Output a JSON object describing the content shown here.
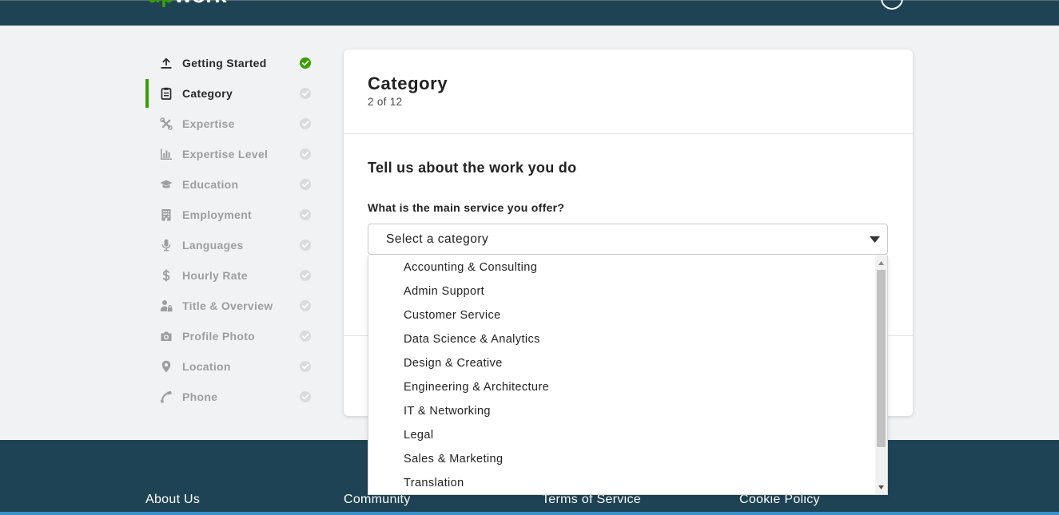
{
  "header": {
    "logo_up": "up",
    "logo_work": "work",
    "avatar_icon": "user-avatar-icon"
  },
  "sidebar": {
    "items": [
      {
        "label": "Getting Started",
        "icon": "upload-icon",
        "completed": true,
        "current": false
      },
      {
        "label": "Category",
        "icon": "clipboard-icon",
        "completed": false,
        "current": true
      },
      {
        "label": "Expertise",
        "icon": "tools-icon",
        "completed": false,
        "current": false
      },
      {
        "label": "Expertise Level",
        "icon": "bar-chart-icon",
        "completed": false,
        "current": false
      },
      {
        "label": "Education",
        "icon": "graduation-cap-icon",
        "completed": false,
        "current": false
      },
      {
        "label": "Employment",
        "icon": "building-icon",
        "completed": false,
        "current": false
      },
      {
        "label": "Languages",
        "icon": "microphone-icon",
        "completed": false,
        "current": false
      },
      {
        "label": "Hourly Rate",
        "icon": "dollar-icon",
        "completed": false,
        "current": false
      },
      {
        "label": "Title & Overview",
        "icon": "user-lock-icon",
        "completed": false,
        "current": false
      },
      {
        "label": "Profile Photo",
        "icon": "camera-icon",
        "completed": false,
        "current": false
      },
      {
        "label": "Location",
        "icon": "map-marker-icon",
        "completed": false,
        "current": false
      },
      {
        "label": "Phone",
        "icon": "phone-icon",
        "completed": false,
        "current": false
      }
    ]
  },
  "card": {
    "title": "Category",
    "step": "2 of 12",
    "section_title": "Tell us about the work you do",
    "question": "What is the main service you offer?",
    "select": {
      "placeholder": "Select a category",
      "expanded": true,
      "options": [
        "Accounting & Consulting",
        "Admin Support",
        "Customer Service",
        "Data Science & Analytics",
        "Design & Creative",
        "Engineering & Architecture",
        "IT & Networking",
        "Legal",
        "Sales & Marketing",
        "Translation"
      ]
    }
  },
  "footer": {
    "links": [
      "About Us",
      "Community",
      "Terms of Service",
      "Cookie Policy"
    ]
  },
  "colors": {
    "brand_green": "#37a000",
    "header_bg": "#1e4355",
    "footer_bg": "#1e4355",
    "page_bg": "#f1f2f4",
    "text_dark": "#222222",
    "text_muted": "#9e9e9e"
  }
}
